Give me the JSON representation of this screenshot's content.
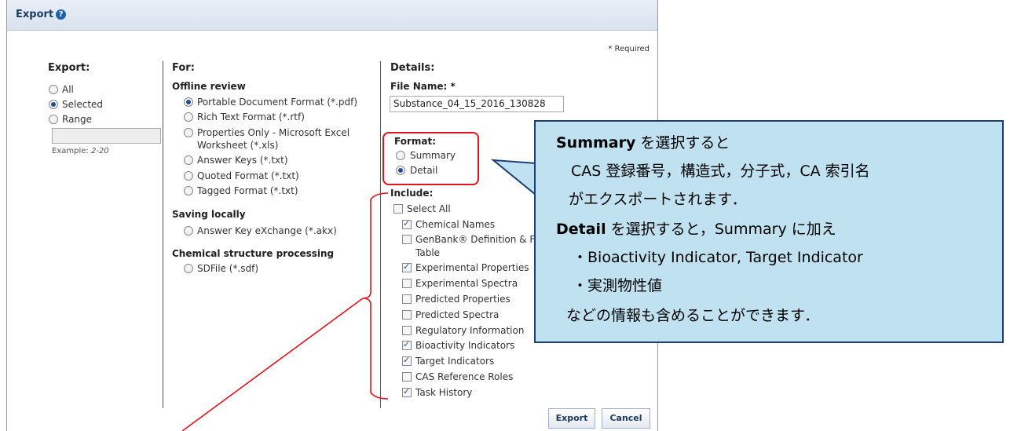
{
  "dialog": {
    "title": "Export",
    "required_note": "* Required"
  },
  "export_col": {
    "heading": "Export:",
    "options": [
      {
        "label": "All",
        "selected": false
      },
      {
        "label": "Selected",
        "selected": true
      },
      {
        "label": "Range",
        "selected": false
      }
    ],
    "range_value": "",
    "example_label": "Example:",
    "example_value": "2-20"
  },
  "for_col": {
    "heading": "For:",
    "groups": [
      {
        "title": "Offline review",
        "options": [
          {
            "label": "Portable Document Format (*.pdf)",
            "selected": true
          },
          {
            "label": "Rich Text Format (*.rtf)",
            "selected": false
          },
          {
            "label": "Properties Only - Microsoft Excel",
            "label2": "Worksheet (*.xls)",
            "selected": false
          },
          {
            "label": "Answer Keys (*.txt)",
            "selected": false
          },
          {
            "label": "Quoted Format (*.txt)",
            "selected": false
          },
          {
            "label": "Tagged Format (*.txt)",
            "selected": false
          }
        ]
      },
      {
        "title": "Saving locally",
        "options": [
          {
            "label": "Answer Key eXchange (*.akx)",
            "selected": false
          }
        ]
      },
      {
        "title": "Chemical structure processing",
        "options": [
          {
            "label": "SDFile (*.sdf)",
            "selected": false
          }
        ]
      }
    ]
  },
  "details_col": {
    "heading": "Details:",
    "file_name_label": "File Name: *",
    "file_name_value": "Substance_04_15_2016_130828",
    "format_label": "Format:",
    "format_options": [
      {
        "label": "Summary",
        "selected": false
      },
      {
        "label": "Detail",
        "selected": true
      }
    ],
    "include_label": "Include:",
    "include_items": [
      {
        "label": "Select All",
        "checked": false
      },
      {
        "label": "Chemical Names",
        "checked": true
      },
      {
        "label": "GenBank® Definition & Fea",
        "label2": "Table",
        "checked": false
      },
      {
        "label": "Experimental Properties",
        "checked": true
      },
      {
        "label": "Experimental Spectra",
        "checked": false
      },
      {
        "label": "Predicted Properties",
        "checked": false
      },
      {
        "label": "Predicted Spectra",
        "checked": false
      },
      {
        "label": "Regulatory Information",
        "checked": false
      },
      {
        "label": "Bioactivity Indicators",
        "checked": true
      },
      {
        "label": "Target Indicators",
        "checked": true
      },
      {
        "label": "CAS Reference Roles",
        "checked": false
      },
      {
        "label": "Task History",
        "checked": true
      }
    ]
  },
  "buttons": {
    "export": "Export",
    "cancel": "Cancel"
  },
  "callout": {
    "line1_bold": "Summary",
    "line1_rest": " を選択すると",
    "line2": "CAS 登録番号，構造式，分子式，CA 索引名",
    "line3": "がエクスポートされます．",
    "line4_bold": "Detail",
    "line4_rest": " を選択すると，Summary に加え",
    "line5": "・Bioactivity Indicator, Target Indicator",
    "line6": "・実測物性値",
    "line7": "などの情報も含めることができます．"
  },
  "colors": {
    "annotation_red": "#e0141e",
    "callout_fill": "#bfe1f0",
    "callout_border": "#1d3f73"
  }
}
